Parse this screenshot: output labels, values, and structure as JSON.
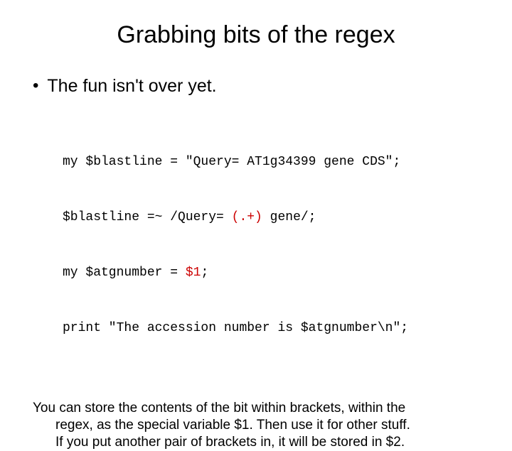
{
  "title": "Grabbing bits of the regex",
  "bullet1": "The fun isn't over yet.",
  "code": {
    "l1a": "my $blastline = \"Query= AT1g34399 gene CDS\";",
    "l2a": "$blastline =~ /Query= ",
    "l2b": "(.+)",
    "l2c": " gene/;",
    "l3a": "my $atgnumber = ",
    "l3b": "$1",
    "l3c": ";",
    "l4a": "print \"The accession number is $atgnumber\\n\";"
  },
  "footer": {
    "line1": "You can store the contents of the bit within brackets, within the",
    "line2": "regex, as the special variable $1. Then use it for other stuff.",
    "line3": "If you put another pair of brackets in, it will be stored in $2."
  }
}
